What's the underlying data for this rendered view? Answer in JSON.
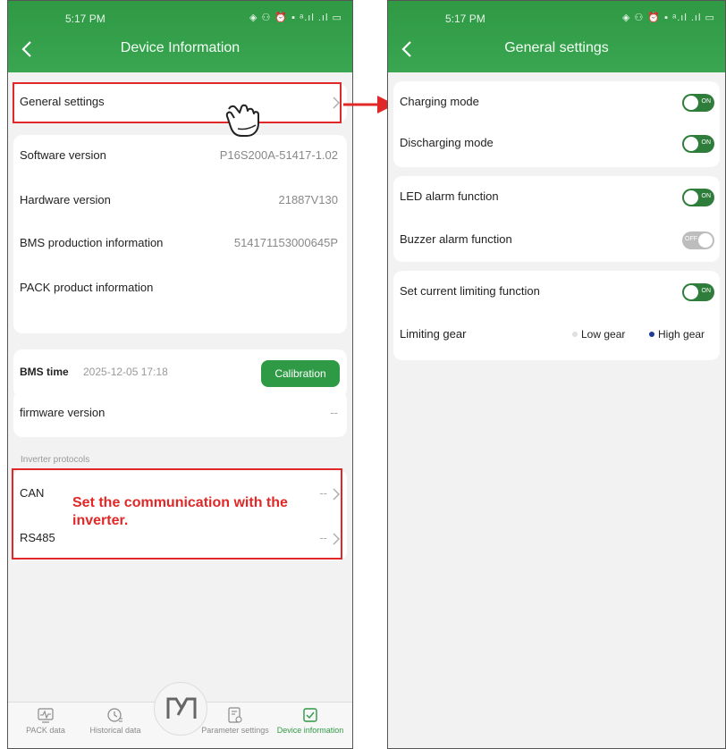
{
  "left_screen": {
    "status": {
      "time": "5:17 PM",
      "icons": "◈ ⚇ ⏰ ▪ ᵃ.ıl .ıl ▭"
    },
    "header": {
      "title": "Device Information"
    },
    "general_settings": {
      "label": "General settings"
    },
    "info_rows": [
      {
        "label": "Software version",
        "value": "P16S200A-51417-1.02"
      },
      {
        "label": "Hardware version",
        "value": "21887V130"
      },
      {
        "label": "BMS production information",
        "value": "514171153000645P"
      },
      {
        "label": "PACK product information",
        "value": ""
      }
    ],
    "bms_time": {
      "label": "BMS time",
      "value": "2025-12-05 17:18",
      "button": "Calibration"
    },
    "firmware": {
      "label": "firmware version",
      "value": "--"
    },
    "inverter": {
      "section_label": "Inverter protocols",
      "rows": [
        {
          "label": "CAN",
          "value": "--"
        },
        {
          "label": "RS485",
          "value": "--"
        }
      ]
    },
    "annotation": "Set the communication with the inverter.",
    "tabs": [
      {
        "label": "PACK data",
        "icon": "pack-data-icon"
      },
      {
        "label": "Historical data",
        "icon": "historical-data-icon"
      },
      {
        "label": "Parameter settings",
        "icon": "parameter-settings-icon"
      },
      {
        "label": "Device information",
        "icon": "device-information-icon"
      }
    ]
  },
  "right_screen": {
    "status": {
      "time": "5:17 PM",
      "icons": "◈ ⚇ ⏰ ▪ ᵃ.ıl .ıl ▭"
    },
    "header": {
      "title": "General settings"
    },
    "groups": [
      {
        "rows": [
          {
            "label": "Charging mode",
            "toggle": "ON"
          },
          {
            "label": "Discharging mode",
            "toggle": "ON"
          }
        ]
      },
      {
        "rows": [
          {
            "label": "LED alarm function",
            "toggle": "ON"
          },
          {
            "label": "Buzzer alarm function",
            "toggle": "OFF"
          }
        ]
      },
      {
        "rows": [
          {
            "label": "Set current limiting function",
            "toggle": "ON"
          }
        ]
      }
    ],
    "limiting_gear": {
      "label": "Limiting gear",
      "options": [
        "Low gear",
        "High gear"
      ],
      "selected": "High gear"
    }
  },
  "colors": {
    "header_green": "#2f9944",
    "toggle_on": "#2e7d3a",
    "toggle_off": "#bdbdbd",
    "annotation_red": "#e02828",
    "radio_selected": "#1f3a93"
  }
}
